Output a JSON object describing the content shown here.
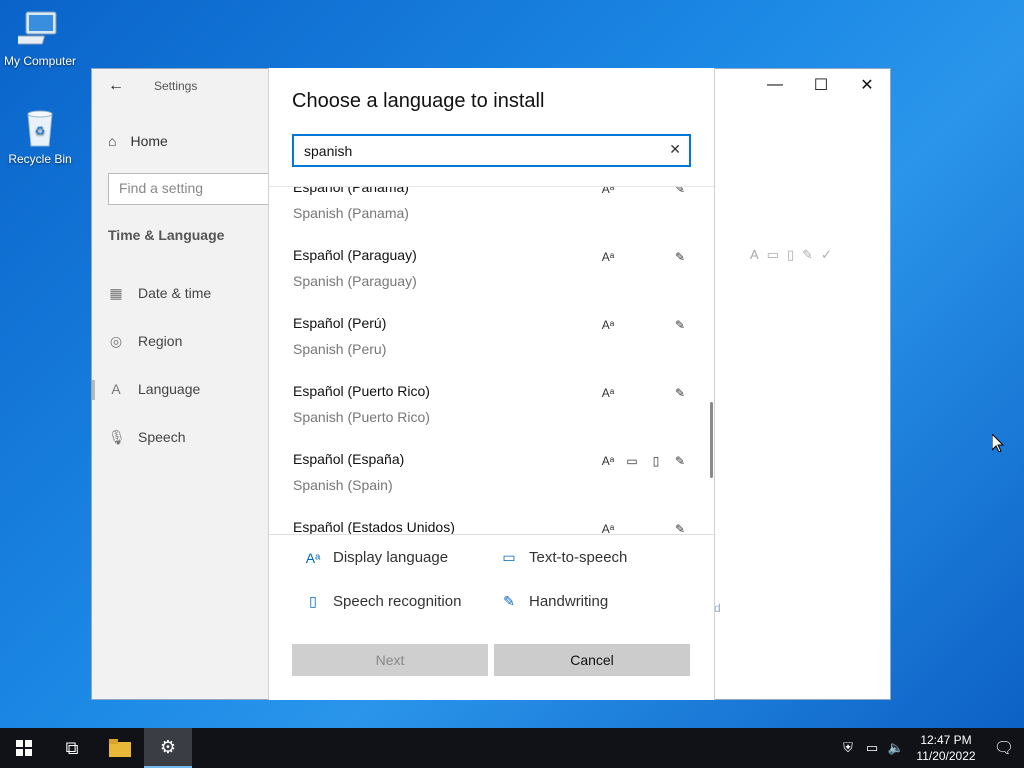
{
  "desktop": {
    "icons": [
      {
        "label": "My Computer"
      },
      {
        "label": "Recycle Bin"
      }
    ]
  },
  "settings": {
    "title": "Settings",
    "home_label": "Home",
    "search_placeholder": "Find a setting",
    "section_label": "Time & Language",
    "nav": [
      {
        "label": "Date & time",
        "icon": "calendar-icon"
      },
      {
        "label": "Region",
        "icon": "globe-icon"
      },
      {
        "label": "Language",
        "icon": "language-icon"
      },
      {
        "label": "Speech",
        "icon": "microphone-icon"
      }
    ],
    "right_tail": "d"
  },
  "dialog": {
    "title": "Choose a language to install",
    "search_value": "spanish",
    "languages": [
      {
        "name": "Español (Panamá)",
        "sub": "Spanish (Panama)",
        "features": [
          "display",
          "handwriting"
        ]
      },
      {
        "name": "Español (Paraguay)",
        "sub": "Spanish (Paraguay)",
        "features": [
          "display",
          "handwriting"
        ]
      },
      {
        "name": "Español (Perú)",
        "sub": "Spanish (Peru)",
        "features": [
          "display",
          "handwriting"
        ]
      },
      {
        "name": "Español (Puerto Rico)",
        "sub": "Spanish (Puerto Rico)",
        "features": [
          "display",
          "handwriting"
        ]
      },
      {
        "name": "Español (España)",
        "sub": "Spanish (Spain)",
        "features": [
          "display",
          "tts",
          "speech",
          "handwriting"
        ]
      },
      {
        "name": "Español (Estados Unidos)",
        "sub": "",
        "features": [
          "display",
          "handwriting"
        ]
      }
    ],
    "legend": {
      "display": "Display language",
      "tts": "Text-to-speech",
      "speech": "Speech recognition",
      "handwriting": "Handwriting"
    },
    "next_label": "Next",
    "cancel_label": "Cancel"
  },
  "taskbar": {
    "time": "12:47 PM",
    "date": "11/20/2022"
  }
}
